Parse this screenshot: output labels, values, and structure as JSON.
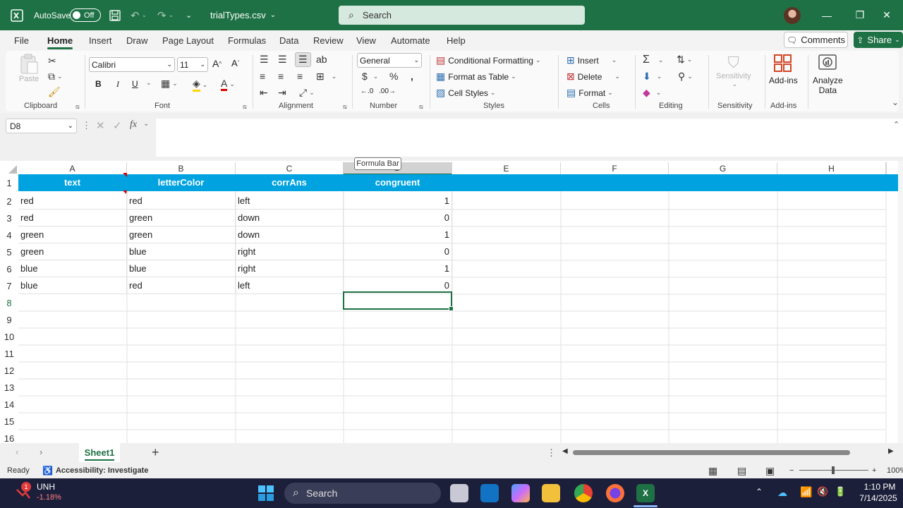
{
  "titlebar": {
    "autosave_label": "AutoSave",
    "autosave_state": "Off",
    "filename": "trialTypes.csv",
    "search_placeholder": "Search"
  },
  "menu": {
    "tabs": [
      "File",
      "Home",
      "Insert",
      "Draw",
      "Page Layout",
      "Formulas",
      "Data",
      "Review",
      "View",
      "Automate",
      "Help"
    ],
    "active_tab": "Home",
    "comments_label": "Comments",
    "share_label": "Share"
  },
  "ribbon": {
    "clipboard": {
      "paste": "Paste",
      "label": "Clipboard"
    },
    "font": {
      "name": "Calibri",
      "size": "11",
      "label": "Font",
      "bold": "B",
      "italic": "I",
      "underline": "U"
    },
    "alignment": {
      "label": "Alignment"
    },
    "number": {
      "format": "General",
      "label": "Number"
    },
    "styles": {
      "conditional": "Conditional Formatting",
      "format_table": "Format as Table",
      "cell_styles": "Cell Styles",
      "label": "Styles"
    },
    "cells": {
      "insert": "Insert",
      "delete": "Delete",
      "format": "Format",
      "label": "Cells"
    },
    "editing": {
      "label": "Editing"
    },
    "sensitivity": {
      "button": "Sensitivity",
      "label": "Sensitivity"
    },
    "addins": {
      "button": "Add-ins",
      "label": "Add-ins"
    },
    "analyze": {
      "line1": "Analyze",
      "line2": "Data"
    }
  },
  "formula_bar": {
    "name_box": "D8",
    "fx": "fx",
    "tooltip": "Formula Bar"
  },
  "sheet": {
    "columns": [
      "A",
      "B",
      "C",
      "D",
      "E",
      "F",
      "G",
      "H"
    ],
    "selected_column": "D",
    "rows": [
      "1",
      "2",
      "3",
      "4",
      "5",
      "6",
      "7",
      "8",
      "9",
      "10",
      "11",
      "12",
      "13",
      "14",
      "15",
      "16"
    ],
    "selected_row": "8",
    "header": [
      "text",
      "letterColor",
      "corrAns",
      "congruent"
    ],
    "data": [
      [
        "red",
        "red",
        "left",
        "1"
      ],
      [
        "red",
        "green",
        "down",
        "0"
      ],
      [
        "green",
        "green",
        "down",
        "1"
      ],
      [
        "green",
        "blue",
        "right",
        "0"
      ],
      [
        "blue",
        "blue",
        "right",
        "1"
      ],
      [
        "blue",
        "red",
        "left",
        "0"
      ]
    ],
    "header_color": "#00a3e0"
  },
  "sheet_tabs": {
    "active": "Sheet1"
  },
  "status": {
    "ready": "Ready",
    "accessibility": "Accessibility: Investigate",
    "zoom": "100%"
  },
  "taskbar": {
    "stock_name": "UNH",
    "stock_change": "-1.18%",
    "badge": "1",
    "search": "Search",
    "time": "1:10 PM",
    "date": "7/14/2025"
  },
  "colors": {
    "excel_green": "#1e7145",
    "taskbar": "#1c1f3a"
  }
}
